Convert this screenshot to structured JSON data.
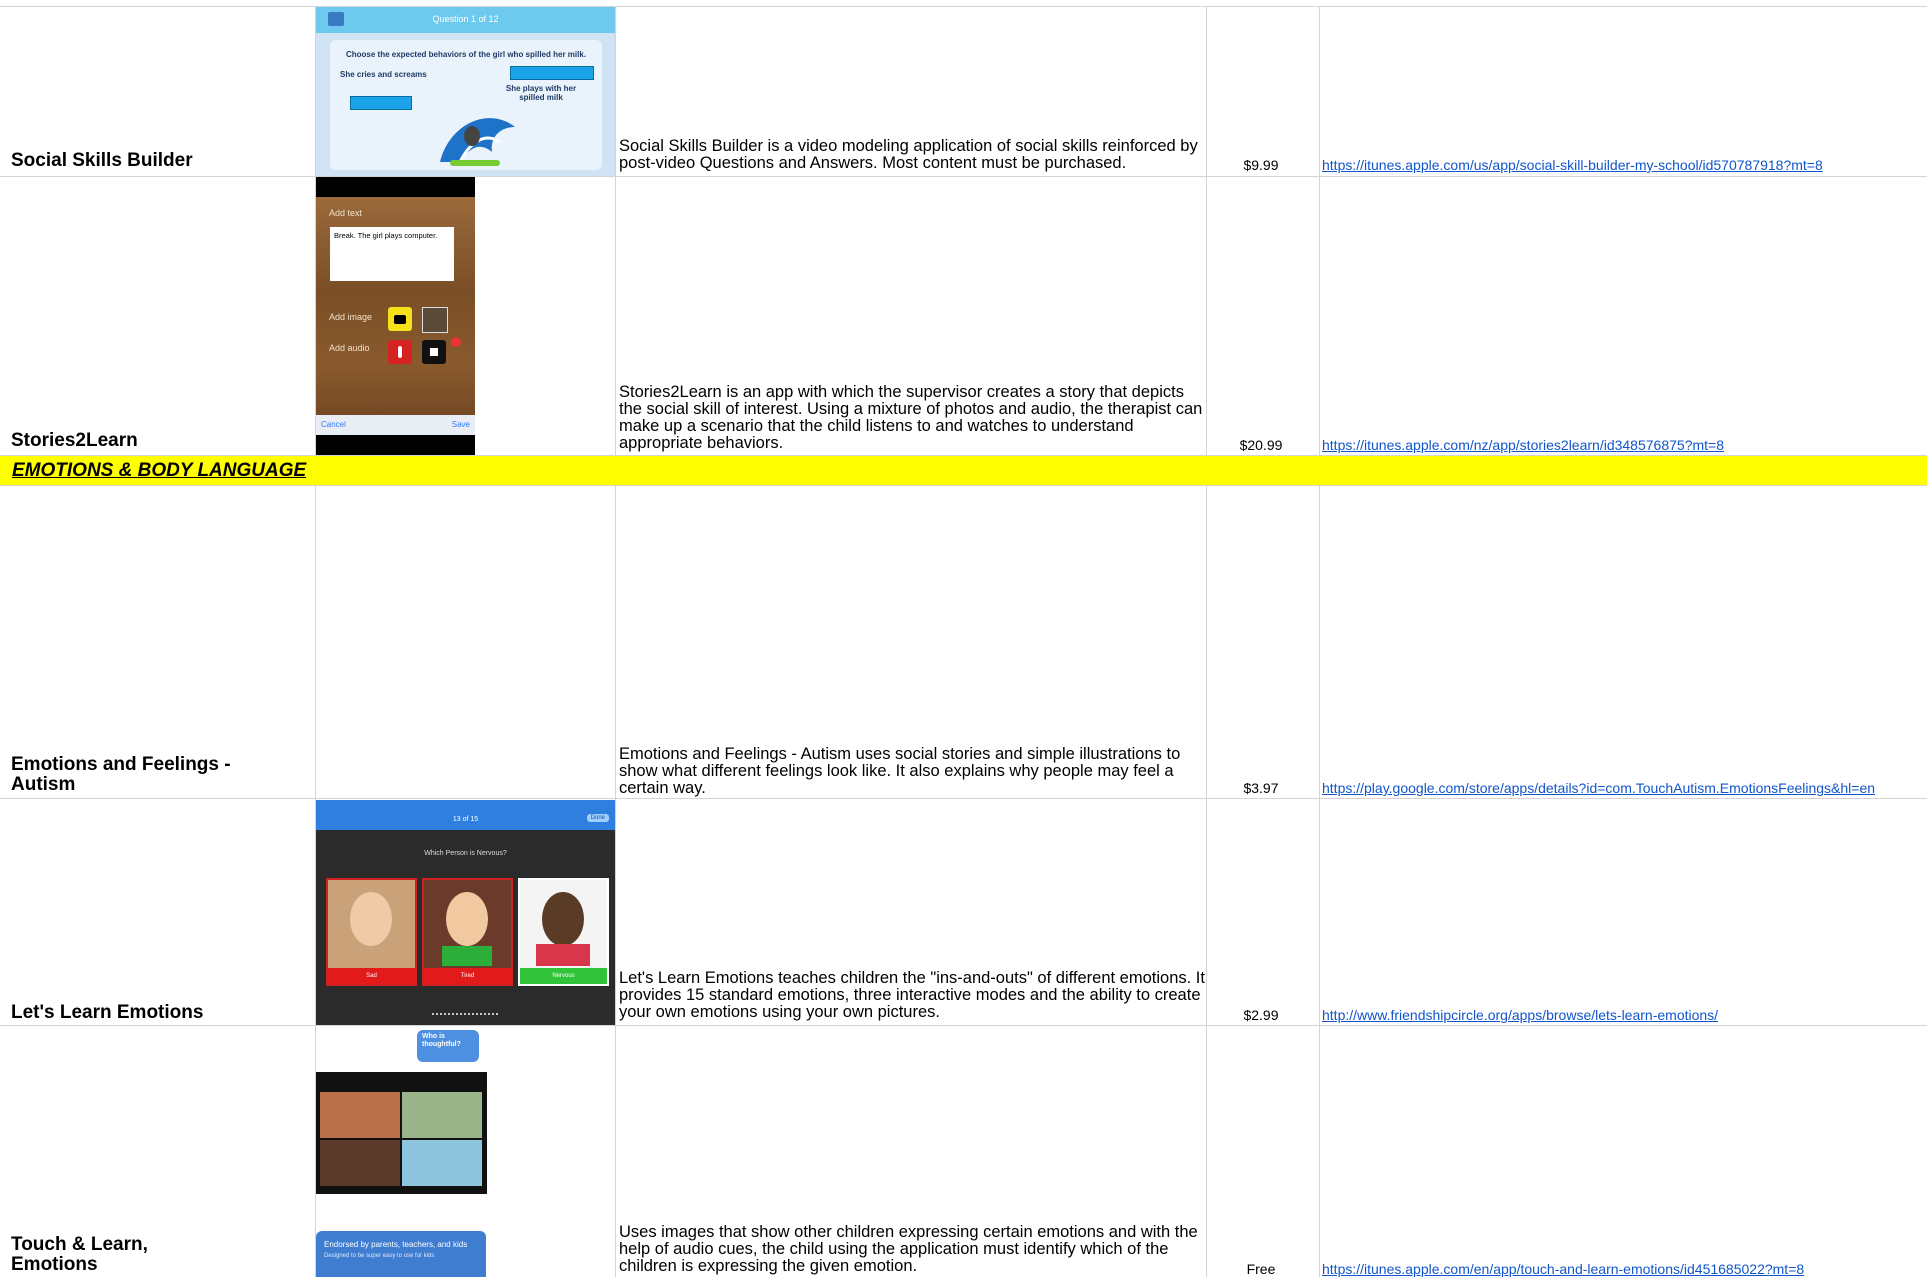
{
  "colors": {
    "link": "#1155cc",
    "section_bg": "#ffff00",
    "grid": "#d4d4d4"
  },
  "section": {
    "title": "EMOTIONS & BODY LANGUAGE"
  },
  "rows": [
    {
      "name": "Social Skills Builder",
      "description": "Social Skills Builder is a video modeling application of social skills reinforced by post-video Questions and Answers. Most content must be purchased.",
      "price": "$9.99",
      "link": "https://itunes.apple.com/us/app/social-skill-builder-my-school/id570787918?mt=8",
      "screenshot": {
        "header": "Question 1 of 12",
        "question": "Choose the expected behaviors of the girl who spilled her milk.",
        "option_a": "She cries and screams",
        "option_b": "She plays with her spilled milk"
      }
    },
    {
      "name": "Stories2Learn",
      "description": "Stories2Learn is an app with which the supervisor creates a story that depicts the social skill of interest. Using a mixture of photos and audio, the therapist can make up a scenario that the child listens to and watches to understand appropriate behaviors.",
      "price": "$20.99",
      "link": "https://itunes.apple.com/nz/app/stories2learn/id348576875?mt=8",
      "screenshot": {
        "add_text": "Add text",
        "text_value": "Break.  The girl plays computer.",
        "add_image": "Add image",
        "add_audio": "Add audio",
        "cancel": "Cancel",
        "save": "Save"
      }
    },
    {
      "name": "Emotions and Feelings - Autism",
      "description": "Emotions and Feelings - Autism uses social stories and simple illustrations to show what different feelings look like. It also explains why people may feel a certain way.",
      "price": "$3.97",
      "link": "https://play.google.com/store/apps/details?id=com.TouchAutism.EmotionsFeelings&hl=en"
    },
    {
      "name": "Let's Learn Emotions",
      "description": "Let's Learn Emotions teaches children the \"ins-and-outs\" of different emotions. It provides 15 standard emotions, three interactive modes and the ability to create your own emotions using your own pictures.",
      "price": "$2.99",
      "link": "http://www.friendshipcircle.org/apps/browse/lets-learn-emotions/",
      "screenshot": {
        "counter": "13 of 15",
        "done": "Done",
        "question": "Which Person is Nervous?",
        "labels": [
          "Sad",
          "Tired",
          "Nervous"
        ]
      }
    },
    {
      "name": "Touch & Learn, Emotions",
      "description": "Uses images that show other children expressing certain emotions and with the help of audio cues, the child using the application must identify which of the children is expressing the given emotion.",
      "price": "Free",
      "link": "https://itunes.apple.com/en/app/touch-and-learn-emotions/id451685022?mt=8",
      "screenshot": {
        "bubble": "Who is thoughtful?",
        "banner": "Endorsed by parents, teachers, and kids",
        "banner_sub": "Designed to be super easy to use for kids"
      }
    }
  ]
}
